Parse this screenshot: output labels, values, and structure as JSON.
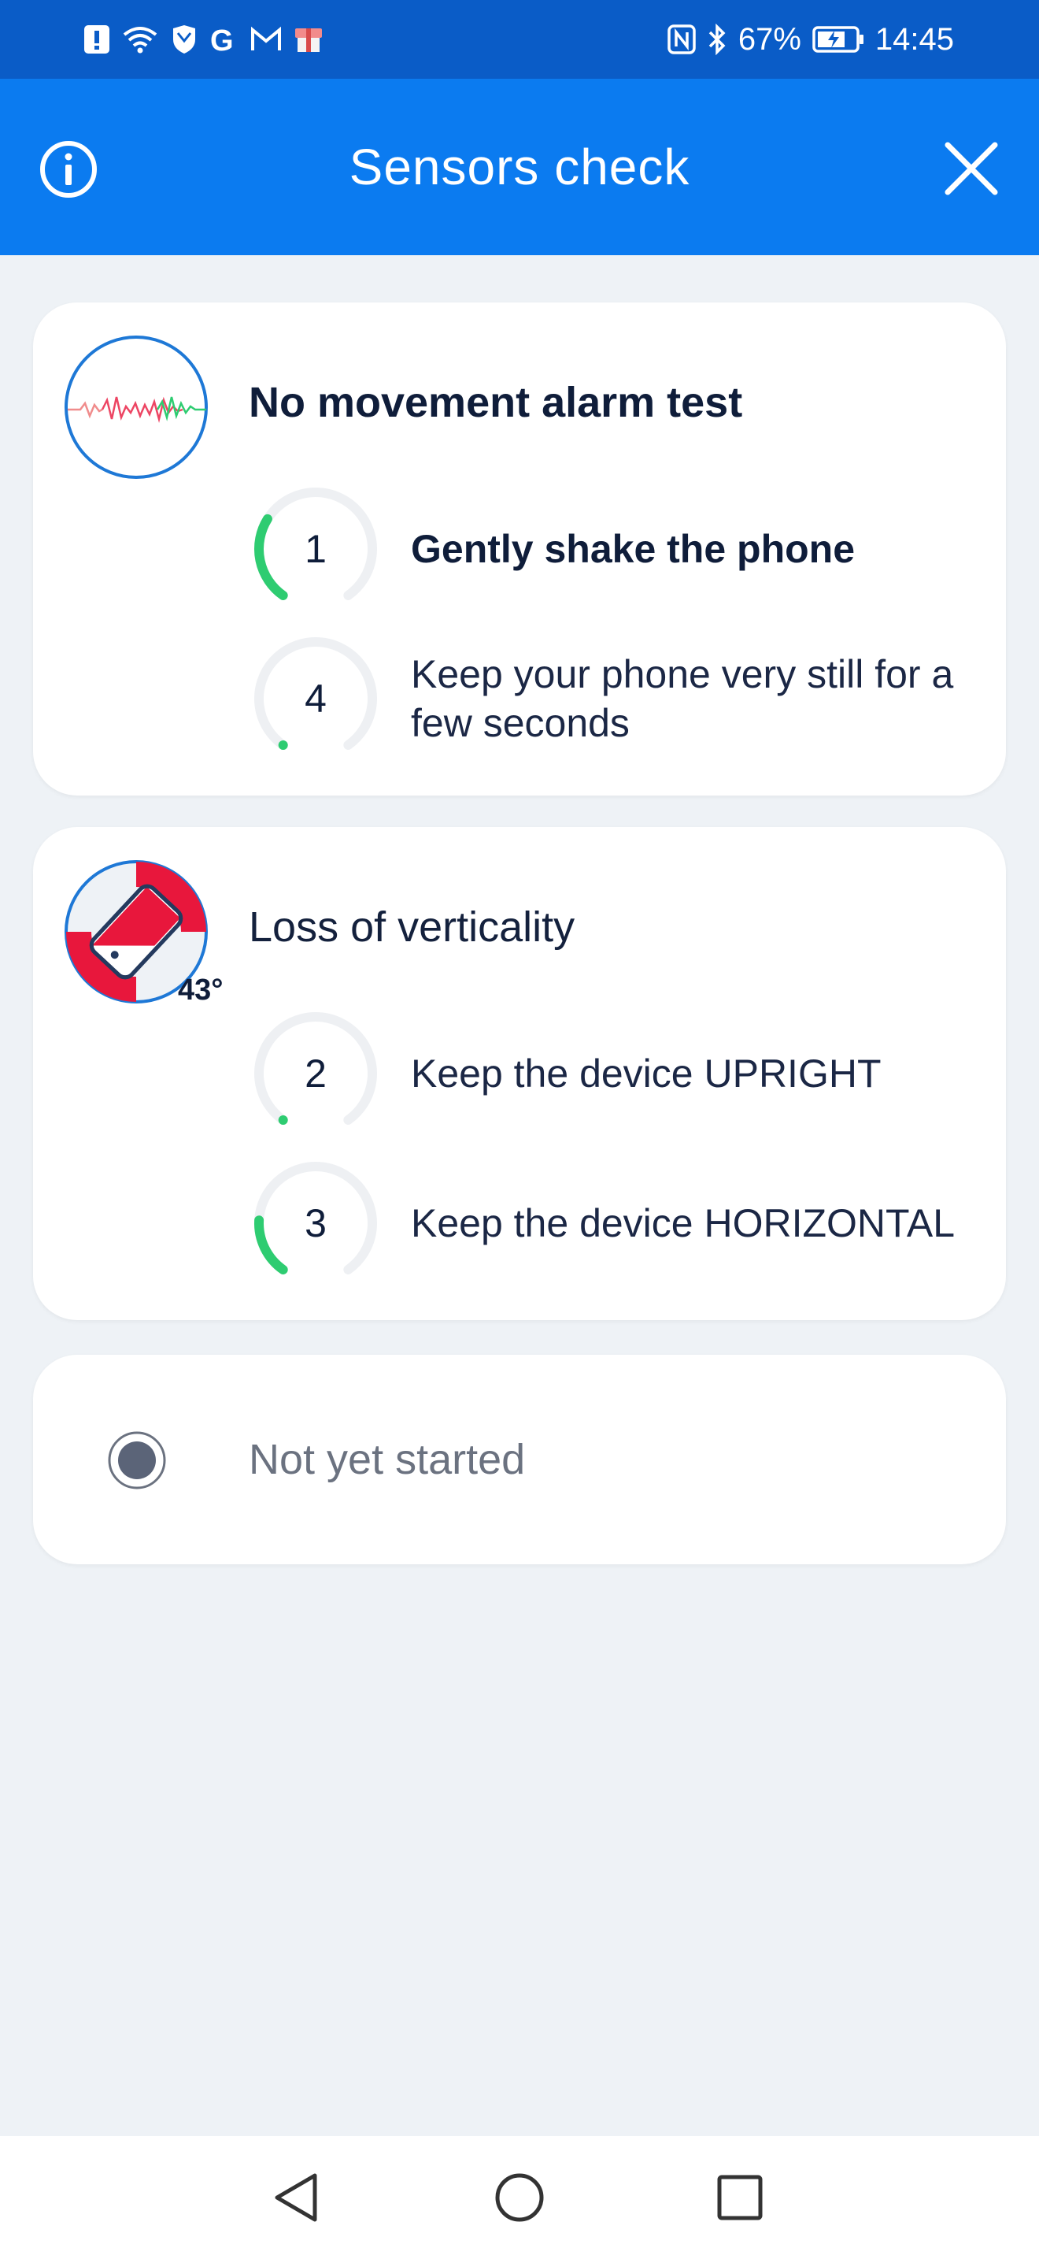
{
  "status_bar": {
    "battery_percent": "67%",
    "time": "14:45",
    "left_icons": [
      "alert-icon",
      "wifi-icon",
      "shield-app-icon",
      "google-icon",
      "gmail-icon",
      "gift-box-icon"
    ],
    "right_icons": [
      "nfc-icon",
      "bluetooth-icon",
      "battery-charging-icon"
    ]
  },
  "app_bar": {
    "title": "Sensors check",
    "info_icon": "info-icon",
    "close_icon": "close-icon"
  },
  "cards": {
    "no_movement": {
      "title": "No movement alarm test",
      "icon": "waveform-icon",
      "steps": [
        {
          "number": "1",
          "label": "Gently shake the phone",
          "progress": 0.3,
          "active": true
        },
        {
          "number": "4",
          "label": "Keep your phone very still for a few seconds",
          "progress": 0.02,
          "active": false
        }
      ]
    },
    "verticality": {
      "title": "Loss of verticality",
      "icon": "tilted-phone-icon",
      "angle": "43°",
      "steps": [
        {
          "number": "2",
          "label": "Keep the device UPRIGHT",
          "progress": 0.02,
          "active": false
        },
        {
          "number": "3",
          "label": "Keep the device HORIZONTAL",
          "progress": 0.2,
          "active": false
        }
      ]
    },
    "status": {
      "label": "Not yet started",
      "icon": "radio-indicator-icon"
    }
  },
  "colors": {
    "status_bar": "#0a5cc7",
    "app_bar": "#0b7bf0",
    "background": "#eef2f6",
    "progress_green": "#2ecc71",
    "ring_track": "#eef0f3",
    "alert_red": "#e8173c",
    "icon_blue": "#1e78d6"
  },
  "nav_bar": {
    "back_icon": "back-triangle-icon",
    "home_icon": "home-circle-icon",
    "recent_icon": "recent-square-icon"
  }
}
